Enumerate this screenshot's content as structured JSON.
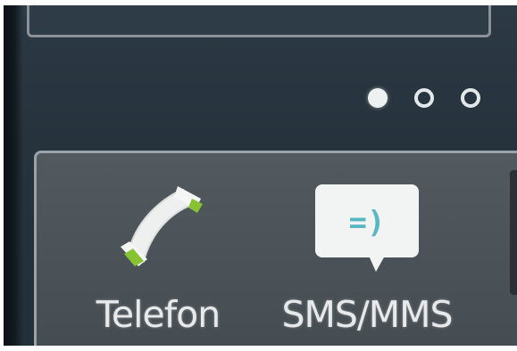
{
  "home_screen": {
    "page_indicator": {
      "count": 3,
      "active_index": 0
    },
    "dock": {
      "apps": [
        {
          "label": "Telefon",
          "icon": "phone-handset-icon",
          "accent_color": "#8bc34a"
        },
        {
          "label": "SMS/MMS",
          "icon": "message-bubble-icon",
          "icon_text": "=)",
          "accent_color": "#59b7c2"
        }
      ]
    }
  }
}
